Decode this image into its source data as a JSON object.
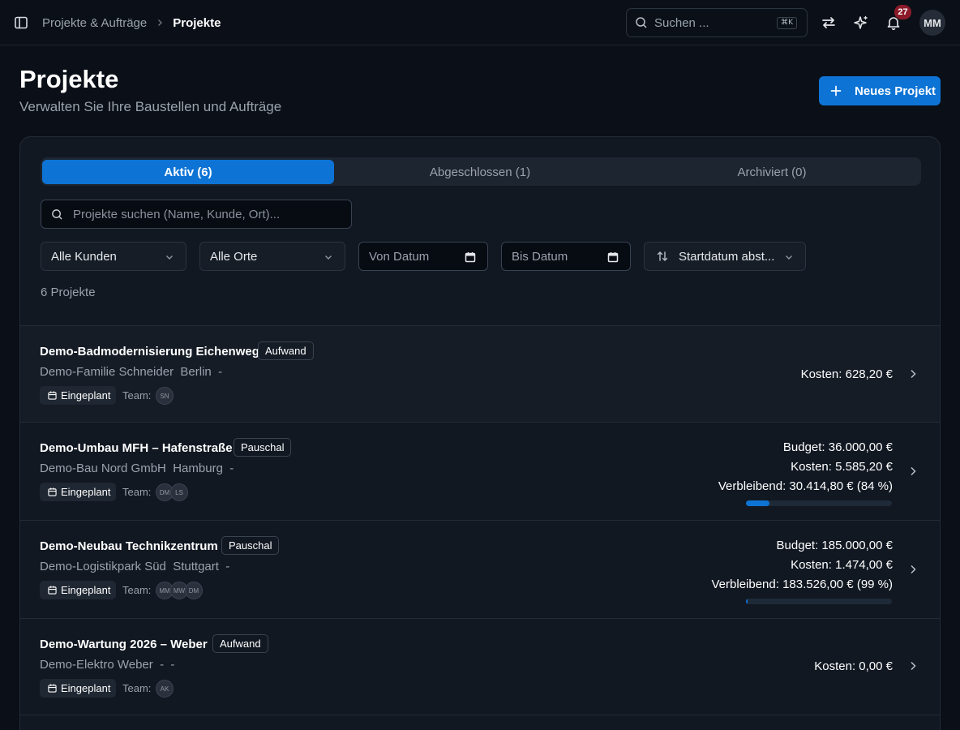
{
  "topbar": {
    "breadcrumb_parent": "Projekte & Aufträge",
    "breadcrumb_current": "Projekte",
    "search_placeholder": "Suchen ...",
    "search_shortcut": "⌘K",
    "notification_count": "27",
    "user_initials": "MM",
    "icons": [
      "sidebar-toggle-icon",
      "search-icon",
      "switch-arrows-icon",
      "sparkles-icon",
      "bell-icon"
    ]
  },
  "header": {
    "title": "Projekte",
    "subtitle": "Verwalten Sie Ihre Baustellen und Aufträge",
    "new_button_label": "Neues Projekt"
  },
  "tabs": [
    {
      "label": "Aktiv (6)",
      "active": true
    },
    {
      "label": "Abgeschlossen (1)",
      "active": false
    },
    {
      "label": "Archiviert (0)",
      "active": false
    }
  ],
  "filters": {
    "search_placeholder": "Projekte suchen (Name, Kunde, Ort)...",
    "customer": "Alle Kunden",
    "location": "Alle Orte",
    "date_from": "Von Datum",
    "date_to": "Bis Datum",
    "sort": "Startdatum abst..."
  },
  "count_label": "6 Projekte",
  "team_label": "Team:",
  "projects": [
    {
      "name": "Demo-Badmodernisierung Eichenweg",
      "type": "Aufwand",
      "meta": "Demo-Familie Schneider  Berlin  -",
      "status": "Eingeplant",
      "team": [
        "SN"
      ],
      "lines": [
        "Kosten: 628,20 €"
      ]
    },
    {
      "name": "Demo-Umbau MFH – Hafenstraße",
      "type": "Pauschal",
      "meta": "Demo-Bau Nord GmbH  Hamburg  -",
      "status": "Eingeplant",
      "team": [
        "DM",
        "LS"
      ],
      "lines": [
        "Budget: 36.000,00 €",
        "Kosten: 5.585,20 €",
        "Verbleibend: 30.414,80 € (84 %)"
      ],
      "budget_used_fraction": 0.16
    },
    {
      "name": "Demo-Neubau Technikzentrum",
      "type": "Pauschal",
      "meta": "Demo-Logistikpark Süd  Stuttgart  -",
      "status": "Eingeplant",
      "team": [
        "MM",
        "MW",
        "DM"
      ],
      "lines": [
        "Budget: 185.000,00 €",
        "Kosten: 1.474,00 €",
        "Verbleibend: 183.526,00 € (99 %)"
      ],
      "budget_used_fraction": 0.01
    },
    {
      "name": "Demo-Wartung 2026 – Weber",
      "type": "Aufwand",
      "meta": "Demo-Elektro Weber  -  -",
      "status": "Eingeplant",
      "team": [
        "AK"
      ],
      "lines": [
        "Kosten: 0,00 €"
      ]
    }
  ],
  "colors": {
    "accent": "#0d74d6",
    "background": "#0b1018",
    "card": "#111822",
    "badge_red": "#8c1b2a"
  }
}
